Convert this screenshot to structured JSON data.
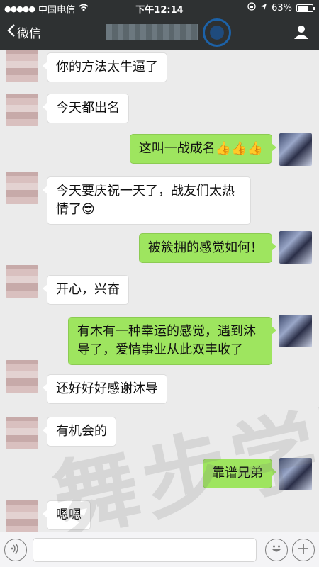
{
  "status": {
    "carrier": "中国电信",
    "time": "下午12:14",
    "battery": "63%",
    "battery_level": 0.63
  },
  "nav": {
    "back_label": "微信"
  },
  "messages": [
    {
      "side": "left",
      "text": "你的方法太牛逼了"
    },
    {
      "side": "left",
      "text": "今天都出名"
    },
    {
      "side": "right",
      "text": "这叫一战成名👍👍👍"
    },
    {
      "side": "left",
      "text": "今天要庆祝一天了，战友们太热情了😎"
    },
    {
      "side": "right",
      "text": "被簇拥的感觉如何！"
    },
    {
      "side": "left",
      "text": "开心，兴奋"
    },
    {
      "side": "right",
      "text": "有木有一种幸运的感觉，遇到沐导了，爱情事业从此双丰收了"
    },
    {
      "side": "left",
      "text": "还好好好感谢沐导"
    },
    {
      "side": "left",
      "text": "有机会的"
    },
    {
      "side": "right",
      "text": "靠谱兄弟"
    },
    {
      "side": "left",
      "text": "嗯嗯"
    }
  ],
  "watermark": "舞步学院",
  "icons": {
    "voice": "voice-icon",
    "emoji": "emoji-icon",
    "plus": "plus-icon",
    "person": "person-icon"
  }
}
